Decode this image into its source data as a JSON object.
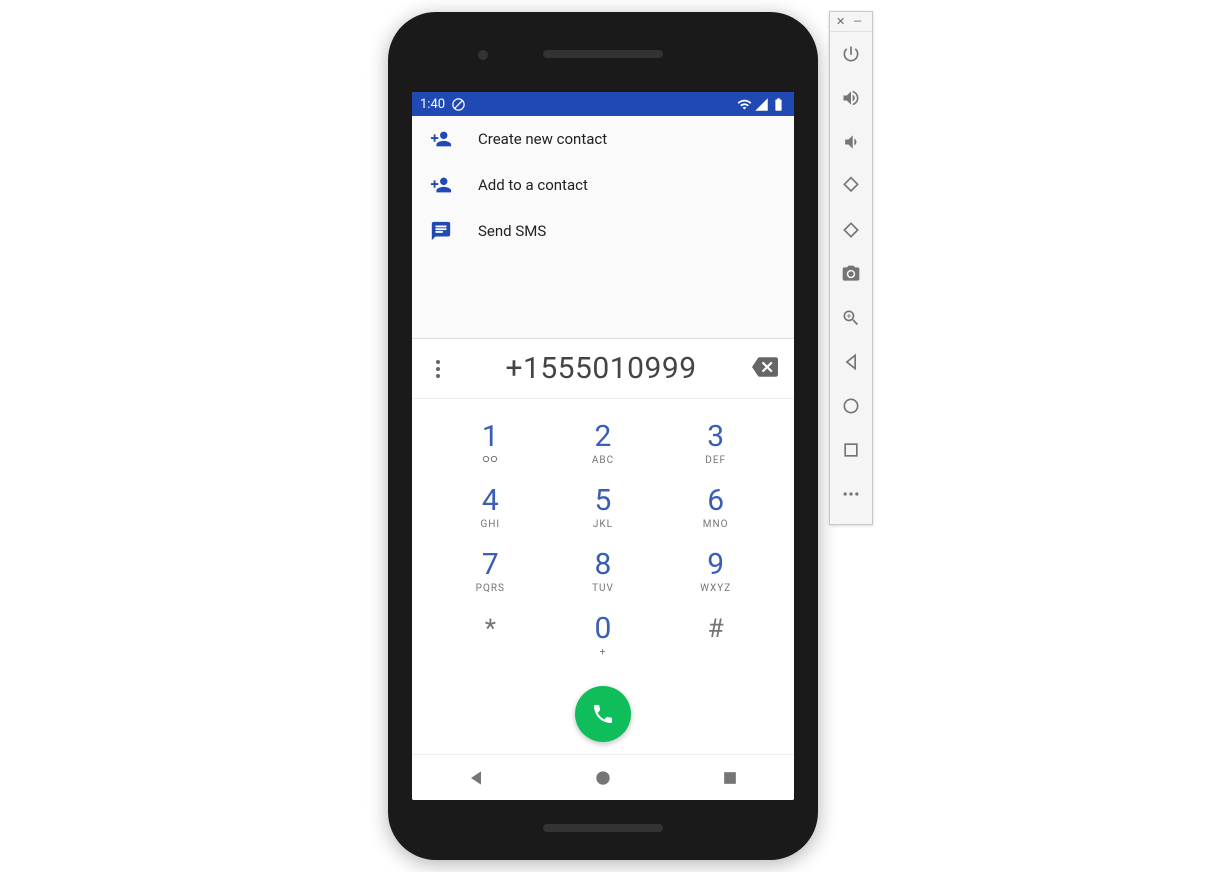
{
  "status_bar": {
    "time": "1:40"
  },
  "actions": [
    {
      "label": "Create new contact"
    },
    {
      "label": "Add to a contact"
    },
    {
      "label": "Send SMS"
    }
  ],
  "dialer": {
    "number": "+1555010999",
    "keypad": [
      {
        "digit": "1",
        "letters": "∞"
      },
      {
        "digit": "2",
        "letters": "ABC"
      },
      {
        "digit": "3",
        "letters": "DEF"
      },
      {
        "digit": "4",
        "letters": "GHI"
      },
      {
        "digit": "5",
        "letters": "JKL"
      },
      {
        "digit": "6",
        "letters": "MNO"
      },
      {
        "digit": "7",
        "letters": "PQRS"
      },
      {
        "digit": "8",
        "letters": "TUV"
      },
      {
        "digit": "9",
        "letters": "WXYZ"
      },
      {
        "digit": "*",
        "letters": ""
      },
      {
        "digit": "0",
        "letters": "+"
      },
      {
        "digit": "#",
        "letters": ""
      }
    ]
  }
}
